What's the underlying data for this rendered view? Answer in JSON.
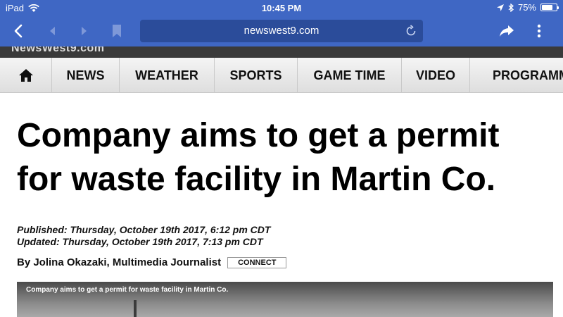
{
  "statusbar": {
    "device": "iPad",
    "time": "10:45 PM",
    "battery_percent_label": "75%",
    "battery_level": 0.75
  },
  "browser": {
    "url": "newswest9.com",
    "accent": "#3f67c4"
  },
  "site": {
    "logo_text": "NewsWest9.com"
  },
  "nav": {
    "items": [
      {
        "label": "NEWS"
      },
      {
        "label": "WEATHER"
      },
      {
        "label": "SPORTS"
      },
      {
        "label": "GAME TIME"
      },
      {
        "label": "VIDEO"
      },
      {
        "label": "PROGRAMM"
      }
    ]
  },
  "article": {
    "headline": "Company aims to get a permit for waste facility in Martin Co.",
    "published": "Published: Thursday, October 19th 2017, 6:12 pm CDT",
    "updated": "Updated: Thursday, October 19th 2017, 7:13 pm CDT",
    "byline": "By Jolina Okazaki, Multimedia Journalist",
    "connect_label": "CONNECT",
    "media_caption": "Company aims to get a permit for waste facility in Martin Co."
  }
}
